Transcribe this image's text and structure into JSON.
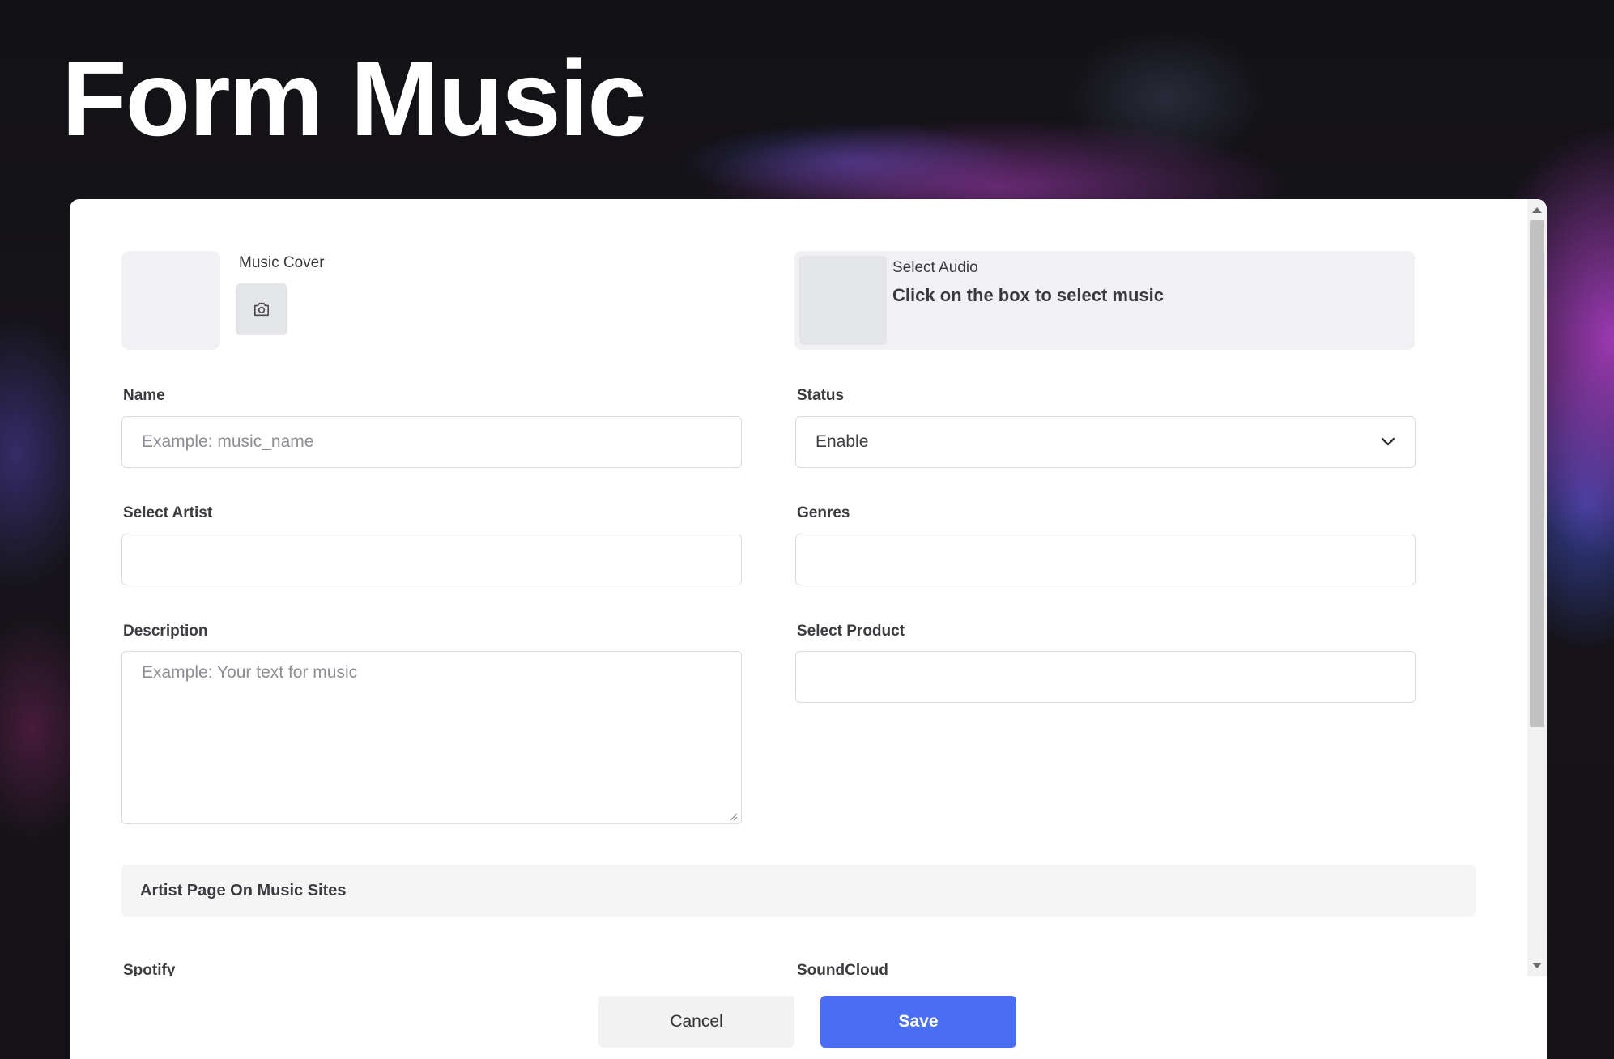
{
  "page": {
    "title": "Form Music"
  },
  "cover": {
    "label": "Music Cover",
    "upload_icon": "camera-icon"
  },
  "audio": {
    "label": "Select Audio",
    "hint": "Click on the box to select music"
  },
  "fields": {
    "name": {
      "label": "Name",
      "value": "",
      "placeholder": "Example: music_name"
    },
    "status": {
      "label": "Status",
      "value": "Enable",
      "icon": "chevron-down-icon"
    },
    "artist": {
      "label": "Select Artist",
      "value": ""
    },
    "genres": {
      "label": "Genres",
      "value": ""
    },
    "description": {
      "label": "Description",
      "value": "",
      "placeholder": "Example: Your text for music"
    },
    "product": {
      "label": "Select Product",
      "value": ""
    },
    "spotify": {
      "label": "Spotify"
    },
    "soundcloud": {
      "label": "SoundCloud"
    }
  },
  "section": {
    "artist_page_title": "Artist Page On Music Sites"
  },
  "actions": {
    "cancel_label": "Cancel",
    "save_label": "Save"
  },
  "colors": {
    "primary": "#4a6ef3",
    "background": "#141216",
    "card": "#ffffff"
  }
}
